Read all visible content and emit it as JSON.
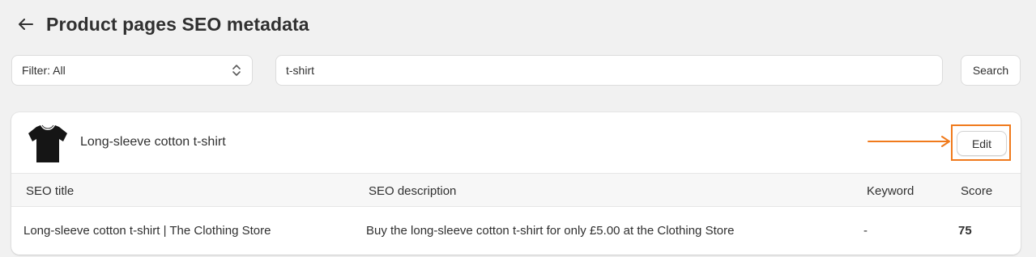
{
  "page": {
    "title": "Product pages SEO metadata"
  },
  "filters": {
    "filter_label": "Filter: All",
    "search_value": "t-shirt",
    "search_button": "Search"
  },
  "product": {
    "name": "Long-sleeve cotton t-shirt",
    "edit_label": "Edit"
  },
  "table": {
    "columns": [
      "SEO title",
      "SEO description",
      "Keyword",
      "Score"
    ],
    "rows": [
      {
        "seo_title": "Long-sleeve cotton t-shirt | The Clothing Store",
        "seo_description": "Buy the long-sleeve cotton t-shirt for only £5.00 at the Clothing Store",
        "keyword": "-",
        "score": "75"
      }
    ]
  },
  "colors": {
    "annotation": "#f07a1c",
    "background": "#f1f1f1"
  }
}
